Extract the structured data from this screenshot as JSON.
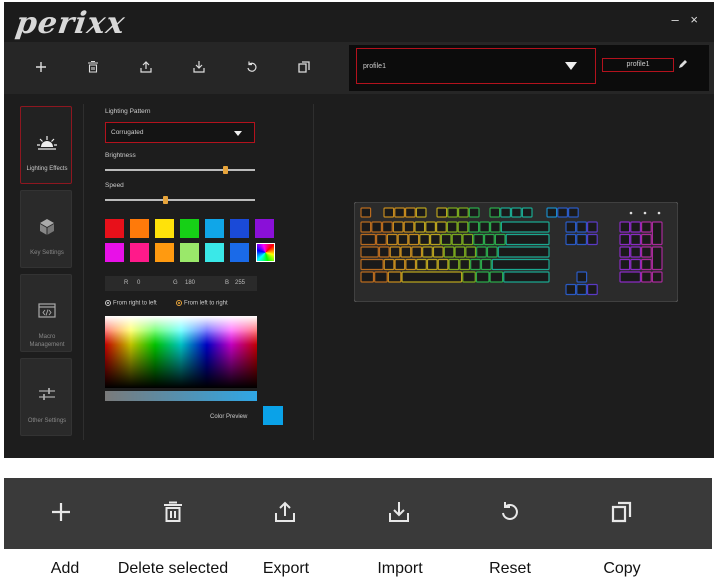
{
  "app": {
    "logo": "perixx",
    "minimize": "–",
    "close": "×"
  },
  "toolbar": {
    "buttons": [
      {
        "name": "add",
        "icon": "plus-icon"
      },
      {
        "name": "delete",
        "icon": "trash-icon"
      },
      {
        "name": "export",
        "icon": "export-icon"
      },
      {
        "name": "import",
        "icon": "import-icon"
      },
      {
        "name": "reset",
        "icon": "reset-icon"
      },
      {
        "name": "copy",
        "icon": "copy-icon"
      }
    ],
    "profile_select": "profile1",
    "profile_name": "profile1"
  },
  "nav": {
    "items": [
      {
        "label": "Lighting Effects",
        "icon": "sun-icon",
        "active": true
      },
      {
        "label": "Key Settings",
        "icon": "cube-icon",
        "active": false
      },
      {
        "label": "Macro Management",
        "icon": "code-window-icon",
        "active": false
      },
      {
        "label": "Other Settings",
        "icon": "sliders-icon",
        "active": false
      }
    ]
  },
  "lighting": {
    "pattern_label": "Lighting Pattern",
    "pattern_value": "Corrugated",
    "brightness_label": "Brightness",
    "brightness_level": 0.8,
    "speed_label": "Speed",
    "speed_level": 0.4,
    "swatches": [
      "#e8101a",
      "#ff7a0a",
      "#ffe20a",
      "#16d016",
      "#10a6e8",
      "#1a4ad8",
      "#8a10d8",
      "#e810e8",
      "#ff1a8a",
      "#ff9a10",
      "#9ae86a",
      "#3ae8e8",
      "#1a6ae8",
      "#ffffff"
    ],
    "r_label": "R",
    "r_value": "0",
    "g_label": "G",
    "g_value": "180",
    "b_label": "B",
    "b_value": "255",
    "direction_left": "From right to left",
    "direction_right": "From left to right",
    "preview_label": "Color Preview",
    "preview_color": "#0aa2e8"
  },
  "legend": {
    "add": "Add",
    "delete": "Delete selected",
    "export": "Export",
    "import": "Import",
    "reset": "Reset",
    "copy": "Copy"
  }
}
